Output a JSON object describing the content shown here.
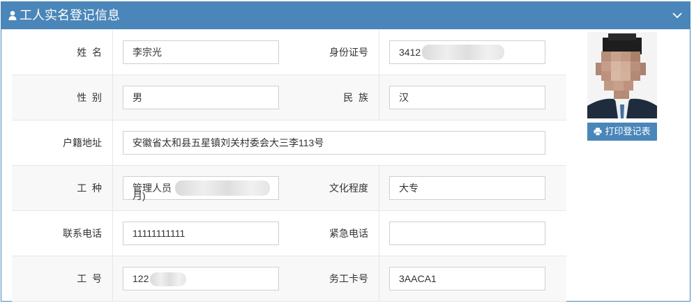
{
  "header": {
    "title": "工人实名登记信息",
    "icon": "user-icon",
    "toggle_icon": "chevron-down-icon"
  },
  "form": {
    "name_label": "姓  名",
    "name_value": "李宗光",
    "id_label": "身份证号",
    "id_value": "3412",
    "gender_label": "性  别",
    "gender_value": "男",
    "ethnicity_label": "民  族",
    "ethnicity_value": "汉",
    "address_label": "户籍地址",
    "address_value": "安徽省太和县五星镇刘关村委会大三李113号",
    "job_label": "工  种",
    "job_value": "管理人员",
    "job_value_overflow": "月)",
    "education_label": "文化程度",
    "education_value": "大专",
    "phone_label": "联系电话",
    "phone_value": "11111111111",
    "emergency_label": "紧急电话",
    "emergency_value": "",
    "worker_no_label": "工  号",
    "worker_no_value": "122",
    "card_no_label": "务工卡号",
    "card_no_value": "3AACA1"
  },
  "actions": {
    "print_label": "打印登记表",
    "print_icon": "printer-icon"
  },
  "colors": {
    "header_bg": "#4a86b9",
    "button_bg": "#4a86b9",
    "row_alt": "#f8f8f8"
  }
}
